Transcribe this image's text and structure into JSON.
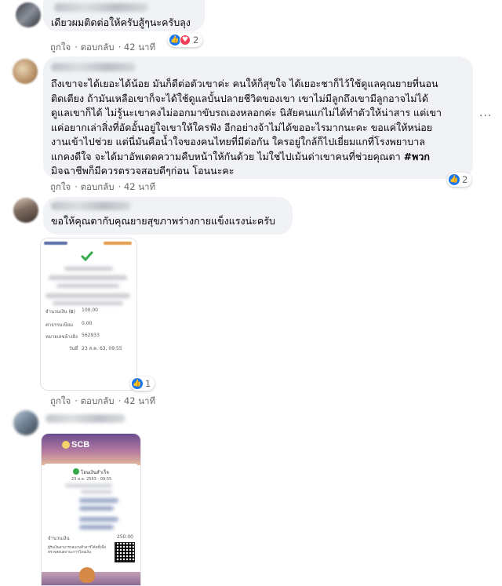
{
  "comments": [
    {
      "text": "เดียวผมติดต่อให้ครับสู้ๆนะครับลุง",
      "actions": {
        "like": "ถูกใจ",
        "reply": "ตอบกลับ",
        "time": "42 นาที"
      },
      "reactions": "2"
    },
    {
      "lines": [
        "ถึงเขาจะได้เยอะได้น้อย มันก็ดีต่อตัวเขาค่ะ คนให้ก็สุขใจ ได้เยอะชาก็ไว้ใช้ดูแลคุณยายที่นอน",
        "ติดเตียง ถ้ามันเหลือเขาก็จะได้ใช้ดูแลบั้นปลายชีวิตของเขา เขาไม่มีลูกถึงเขามีลูกอาจไม่ได้",
        "ดูแลเขาก็ได้ ไม่รู้นะเขาคงไม่ออกมาขับรถเองหลอกค่ะ นิสัยคนแก่ไม่ได้ทำตัวให้น่าสาร แต่เขา",
        "แค่อยากเล่าสิ่งที่อัดอั้นอยู่ใจเขาให้ใครฟัง อีกอย่างจ้าไม่ได้ขออะไรมากนะคะ ขอแค่ให้หน่อย",
        "งานเข้าไปช่วย แต่นี่มันคือน้ำใจของคนไทยที่มีต่อกัน ใครอยู่ใกล้ก็ไปเยี่ยมแกที่โรงพยาบาล",
        "แกคงดีใจ จะได้มาอัพเดตความคืบหน้าให้กันด้วย ไม่ใช่ไปเม้นด่าเขาคนที่ช่วยคุณตา ",
        "มิจฉาชีพก็มีควรตรวจสอบดีๆก่อน โอนนะคะ"
      ],
      "hashtag": "#พวก",
      "actions": {
        "like": "ถูกใจ",
        "reply": "ตอบกลับ",
        "time": "42 นาที"
      },
      "reactions": "2"
    },
    {
      "text": "ขอให้คุณตากับคุณยายสุขภาพร่างกายแข็งแรงน่ะครับ",
      "actions": {
        "like": "ถูกใจ",
        "reply": "ตอบกลับ",
        "time": "42 นาที"
      },
      "reactions": "1",
      "slip": {
        "amount_label": "จำนวนเงิน (฿)",
        "amount": "100.00",
        "fee_label": "ค่าธรรมเนียม",
        "fee": "0.00",
        "ref_label": "หมายเลขอ้างอิง",
        "ref": "562933",
        "date_label": "วันที่",
        "date": "23 ส.ค. 63, 09:55"
      }
    },
    {
      "slip": {
        "brand": "SCB",
        "status": "โอนเงินสำเร็จ",
        "date": "23 ส.ค. 2563 - 09:55",
        "amount_label": "จำนวนเงิน",
        "amount": "250.00",
        "footer": "ผู้รับเงินสามารถสแกนคิวอาร์โค้ดนี้เพื่อตรวจสอบสถานะการโอนเงิน"
      }
    }
  ],
  "colors": {
    "bubble": "#f0f2f5",
    "meta": "#65676b",
    "like": "#1877f2",
    "love": "#f33e58",
    "scb": "#4e2a84"
  }
}
